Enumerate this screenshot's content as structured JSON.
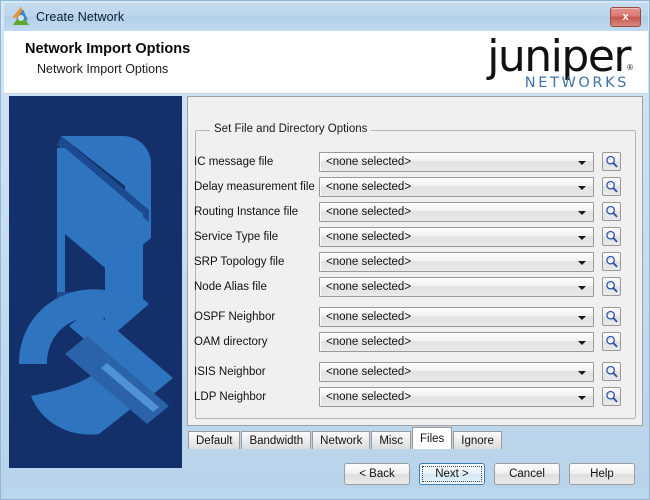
{
  "window": {
    "title": "Create Network",
    "app_icon": "juniper-swirl-icon",
    "close_label": "x"
  },
  "header": {
    "title": "Network Import Options",
    "subtitle": "Network Import Options",
    "logo_word": "juniper",
    "logo_registered": "®",
    "logo_sub": "NETWORKS"
  },
  "banner": {
    "name": "network-import-illustration"
  },
  "content": {
    "group_legend": "Set File and Directory Options",
    "fields": [
      {
        "label": "IC message file",
        "value": "<none selected>",
        "gap": false
      },
      {
        "label": "Delay measurement file",
        "value": "<none selected>",
        "gap": false
      },
      {
        "label": "Routing Instance file",
        "value": "<none selected>",
        "gap": false
      },
      {
        "label": "Service Type file",
        "value": "<none selected>",
        "gap": false
      },
      {
        "label": "SRP Topology file",
        "value": "<none selected>",
        "gap": false
      },
      {
        "label": "Node Alias file",
        "value": "<none selected>",
        "gap": false
      },
      {
        "label": "OSPF Neighbor",
        "value": "<none selected>",
        "gap": true
      },
      {
        "label": "OAM directory",
        "value": "<none selected>",
        "gap": false
      },
      {
        "label": "ISIS Neighbor",
        "value": "<none selected>",
        "gap": true
      },
      {
        "label": "LDP Neighbor",
        "value": "<none selected>",
        "gap": false
      }
    ],
    "browse_icon": "magnifier-icon"
  },
  "tabs": [
    {
      "label": "Default",
      "active": false
    },
    {
      "label": "Bandwidth",
      "active": false
    },
    {
      "label": "Network",
      "active": false
    },
    {
      "label": "Misc",
      "active": false
    },
    {
      "label": "Files",
      "active": true
    },
    {
      "label": "Ignore",
      "active": false
    }
  ],
  "footer": {
    "buttons": [
      {
        "label": "< Back",
        "focused": false
      },
      {
        "label": "Next >",
        "focused": true
      },
      {
        "label": "Cancel",
        "focused": false
      },
      {
        "label": "Help",
        "focused": false
      }
    ]
  },
  "colors": {
    "window_frame": "#bcd8ef",
    "titlebar": "#bcd6ec",
    "close_red": "#c4564c",
    "banner_bg": "#13306b",
    "banner_fg": "#2f74be",
    "logo_blue": "#3f72a8",
    "focus_blue": "#3c7fb1",
    "panel_bg": "#f0f0f0"
  }
}
